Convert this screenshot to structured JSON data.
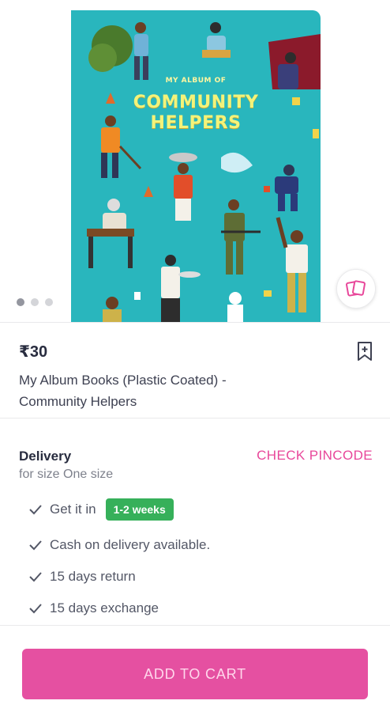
{
  "gallery": {
    "book_title_small": "MY ALBUM OF",
    "book_title_line1": "COMMUNITY",
    "book_title_line2": "HELPERS",
    "dots_total": 3,
    "active_dot": 1
  },
  "product": {
    "price": "₹30",
    "title": "My Album Books (Plastic Coated) - Community Helpers"
  },
  "delivery": {
    "title": "Delivery",
    "subtitle": "for size One size",
    "check_pincode": "CHECK PINCODE",
    "get_it_in": "Get it in",
    "eta_badge": "1-2 weeks",
    "cod": "Cash on delivery available.",
    "return": "15 days return",
    "exchange": "15 days exchange"
  },
  "footer": {
    "add_to_cart": "ADD TO CART"
  },
  "colors": {
    "accent": "#e8479a",
    "button": "#e550a1",
    "badge_green": "#36b05a",
    "book_teal": "#29b6bd"
  },
  "icons": {
    "similar": "similar-items-icon",
    "wishlist": "bookmark-plus-icon",
    "tick": "check-icon"
  }
}
